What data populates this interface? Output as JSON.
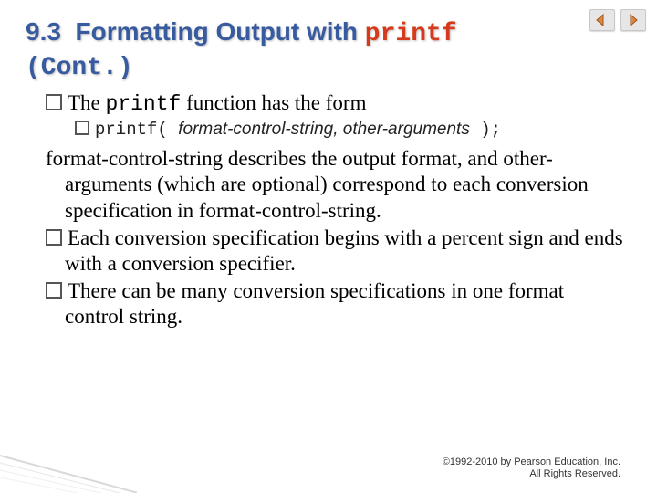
{
  "heading": {
    "section_number": "9.3",
    "title_plain": "Formatting Output with",
    "title_code_after": "printf",
    "cont": "(Cont.)"
  },
  "bullets": {
    "b1": {
      "pre": "The ",
      "code": "printf",
      "post": " function has the form"
    },
    "b1_sub": {
      "code_pre": "printf( ",
      "args": "format-control-string, other-arguments",
      "code_post": " );"
    },
    "p1": "format-control-string describes the output format, and other-arguments (which are optional) correspond to each conversion specification in format-control-string.",
    "b2": "Each conversion specification begins with a percent sign and ends with a conversion specifier.",
    "b3": "There can be many conversion specifications in one format control string."
  },
  "footer": {
    "line1": "©1992-2010 by Pearson Education, Inc.",
    "line2": "All Rights Reserved."
  }
}
